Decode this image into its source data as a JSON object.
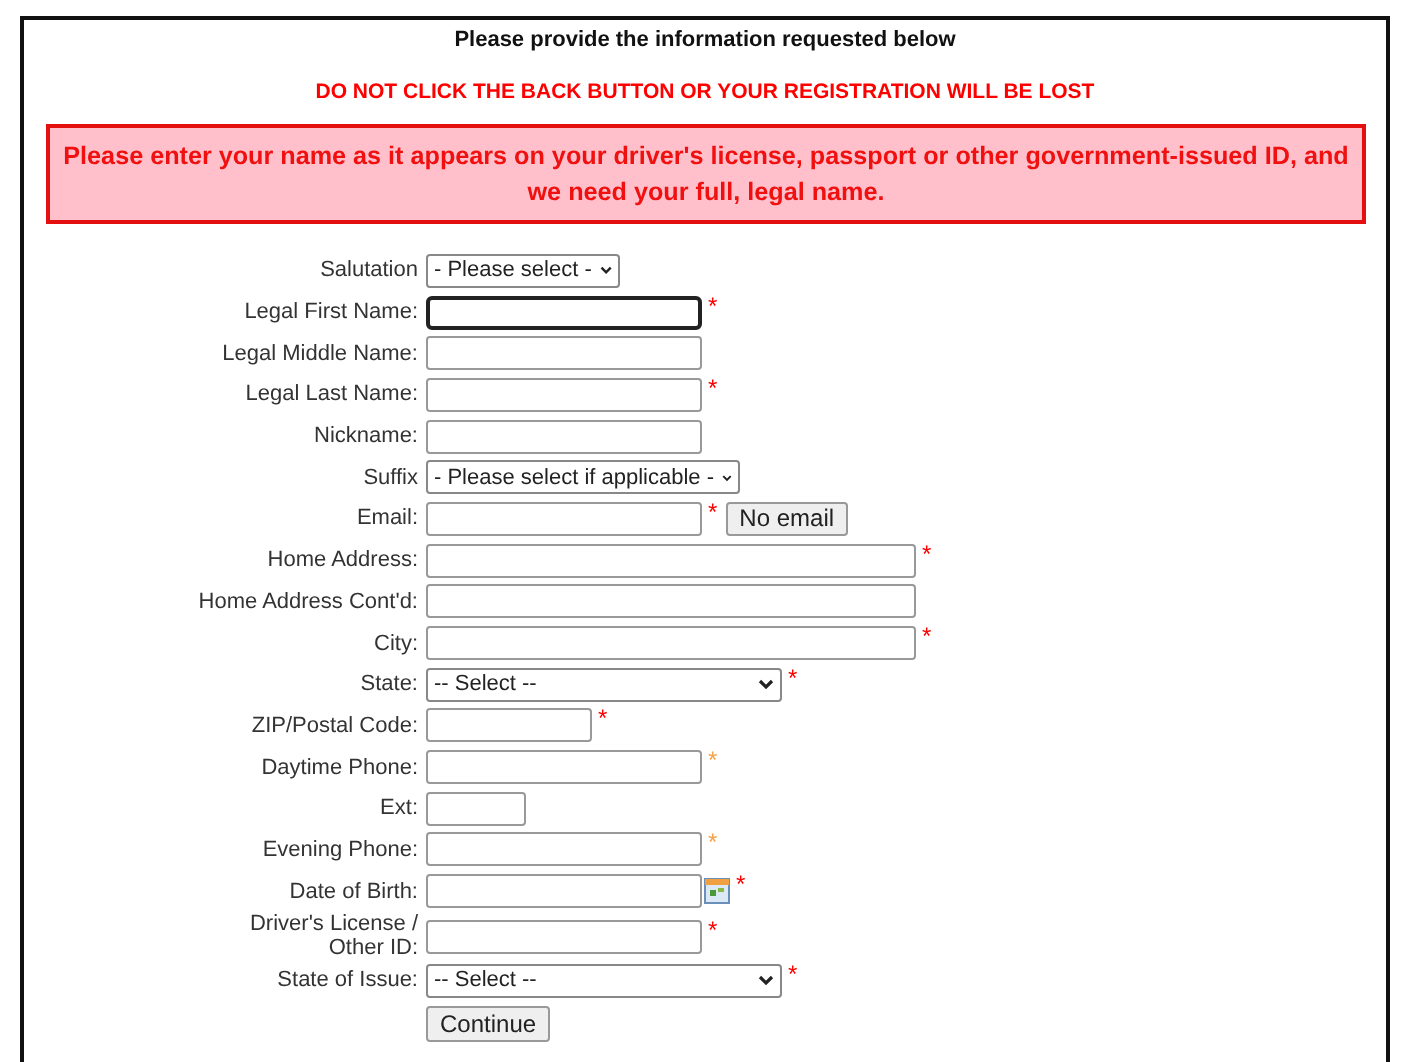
{
  "header": {
    "title": "Please provide the information requested below",
    "warning": "DO NOT CLICK THE BACK BUTTON OR YOUR REGISTRATION WILL BE LOST",
    "notice": "Please enter your name as it appears on your driver's license, passport or other government-issued ID, and we need your full, legal name."
  },
  "fields": [
    {
      "label": "Salutation",
      "kind": "select",
      "value": "- Please select -"
    },
    {
      "label": "Legal First Name:",
      "kind": "text",
      "focused": true,
      "mark": {
        "text": "*",
        "color": "#ff0000"
      }
    },
    {
      "label": "Legal Middle Name:",
      "kind": "text",
      "focused": false
    },
    {
      "label": "Legal Last Name:",
      "kind": "text",
      "focused": false,
      "mark": {
        "text": "*",
        "color": "#ff0000"
      }
    },
    {
      "label": "Nickname:",
      "kind": "text",
      "focused": false
    },
    {
      "label": "Suffix",
      "kind": "select",
      "value": "- Please select if applicable -"
    },
    {
      "label": "Email:",
      "kind": "text",
      "focused": false,
      "mark": {
        "text": "*",
        "color": "#ff0000"
      },
      "button": "No email"
    },
    {
      "label": "Home Address:",
      "kind": "text",
      "focused": false,
      "mark": {
        "text": "*",
        "color": "#ff0000"
      }
    },
    {
      "label": "Home Address Cont'd:",
      "kind": "text",
      "focused": false
    },
    {
      "label": "City:",
      "kind": "text",
      "focused": false,
      "mark": {
        "text": "*",
        "color": "#ff0000"
      }
    },
    {
      "label": "State:",
      "kind": "select",
      "value": "-- Select --",
      "mark": {
        "text": "*",
        "color": "#ff0000"
      }
    },
    {
      "label": "ZIP/Postal Code:",
      "kind": "text",
      "focused": false,
      "mark": {
        "text": "*",
        "color": "#ff0000"
      }
    },
    {
      "label": "Daytime Phone:",
      "kind": "text",
      "focused": false,
      "mark": {
        "text": "*",
        "color": "#f7a24a"
      }
    },
    {
      "label": "Ext:",
      "kind": "text",
      "focused": false
    },
    {
      "label": "Evening Phone:",
      "kind": "text",
      "focused": false,
      "mark": {
        "text": "*",
        "color": "#f7a24a"
      }
    },
    {
      "label": "Date of Birth:",
      "kind": "date",
      "focused": false,
      "mark": {
        "text": "*",
        "color": "#ff0000"
      }
    },
    {
      "label": "Driver's License /\nOther ID:",
      "kind": "text",
      "focused": false,
      "mark": {
        "text": "*",
        "color": "#ff0000"
      }
    },
    {
      "label": "State of Issue:",
      "kind": "select",
      "value": "-- Select --",
      "mark": {
        "text": "*",
        "color": "#ff0000"
      }
    }
  ],
  "submit": "Continue"
}
